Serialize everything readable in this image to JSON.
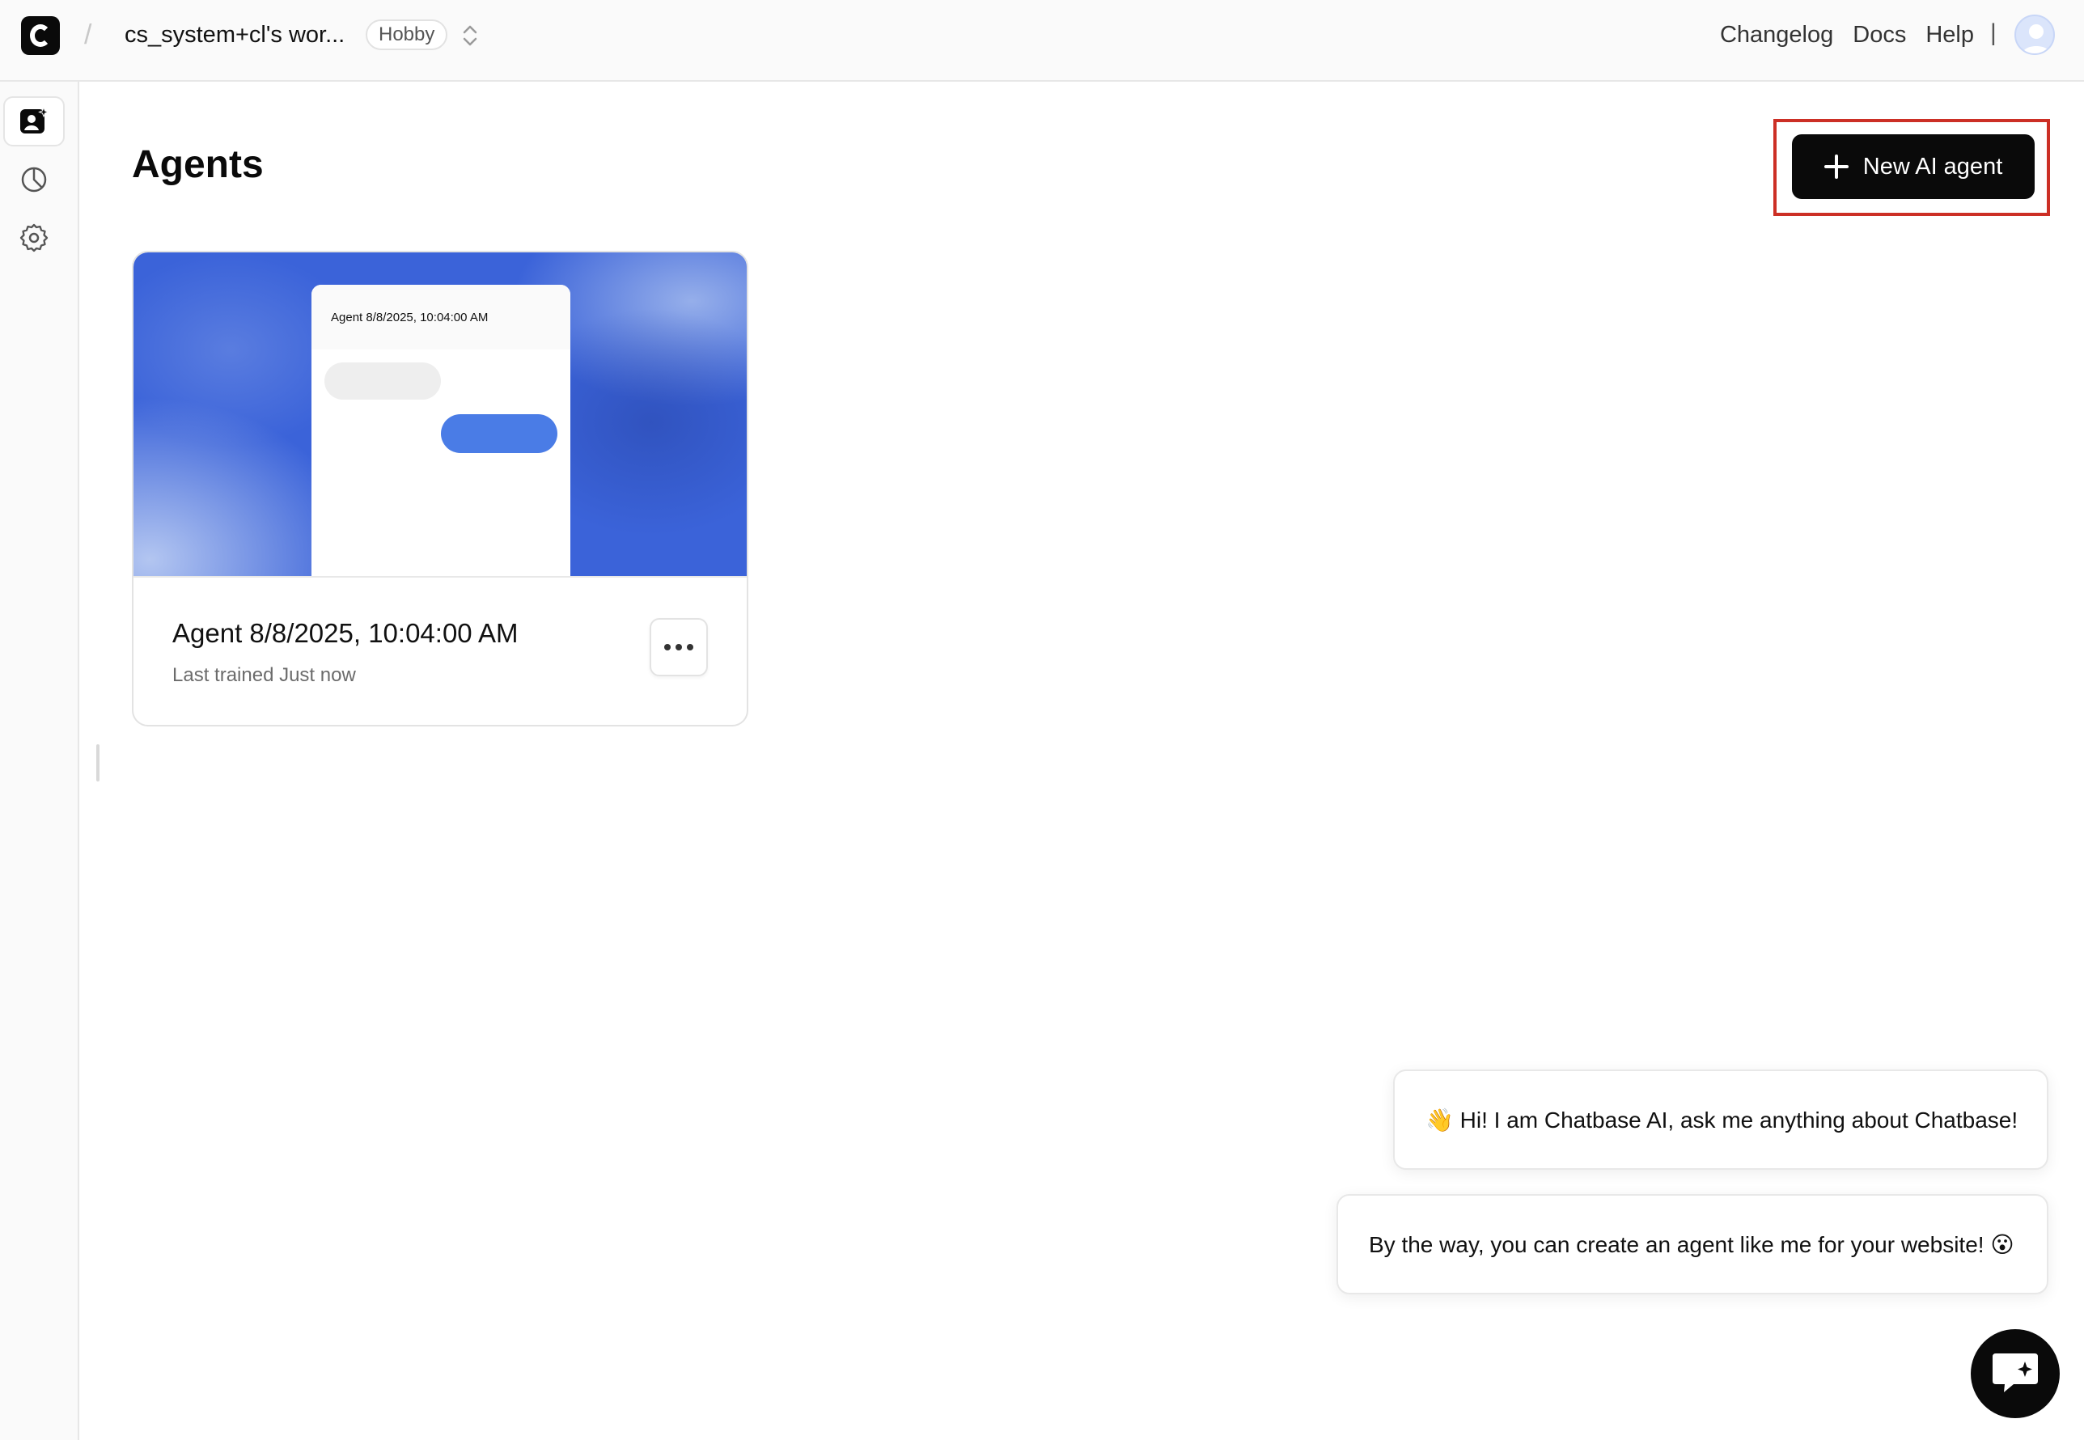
{
  "header": {
    "workspace_name": "cs_system+cl's wor...",
    "plan_badge": "Hobby",
    "nav_links": [
      "Changelog",
      "Docs",
      "Help"
    ],
    "separator": "|"
  },
  "sidebar": {
    "items": [
      {
        "name": "agents",
        "icon": "agent-icon",
        "active": true
      },
      {
        "name": "usage",
        "icon": "pie-chart-icon",
        "active": false
      },
      {
        "name": "settings",
        "icon": "gear-icon",
        "active": false
      }
    ]
  },
  "main": {
    "title": "Agents",
    "new_agent_label": "New AI agent"
  },
  "agents": [
    {
      "preview_title": "Agent 8/8/2025, 10:04:00 AM",
      "name": "Agent 8/8/2025, 10:04:00 AM",
      "last_trained": "Last trained Just now"
    }
  ],
  "chat_widget": {
    "messages": [
      "👋 Hi! I am Chatbase AI, ask me anything about Chatbase!",
      "By the way, you can create an agent like me for your website! 😮"
    ]
  },
  "colors": {
    "accent_highlight": "#cc2f25",
    "primary_button": "#0a0a0a",
    "preview_blue": "#3b63d9",
    "bubble_blue": "#4a7ce6"
  }
}
